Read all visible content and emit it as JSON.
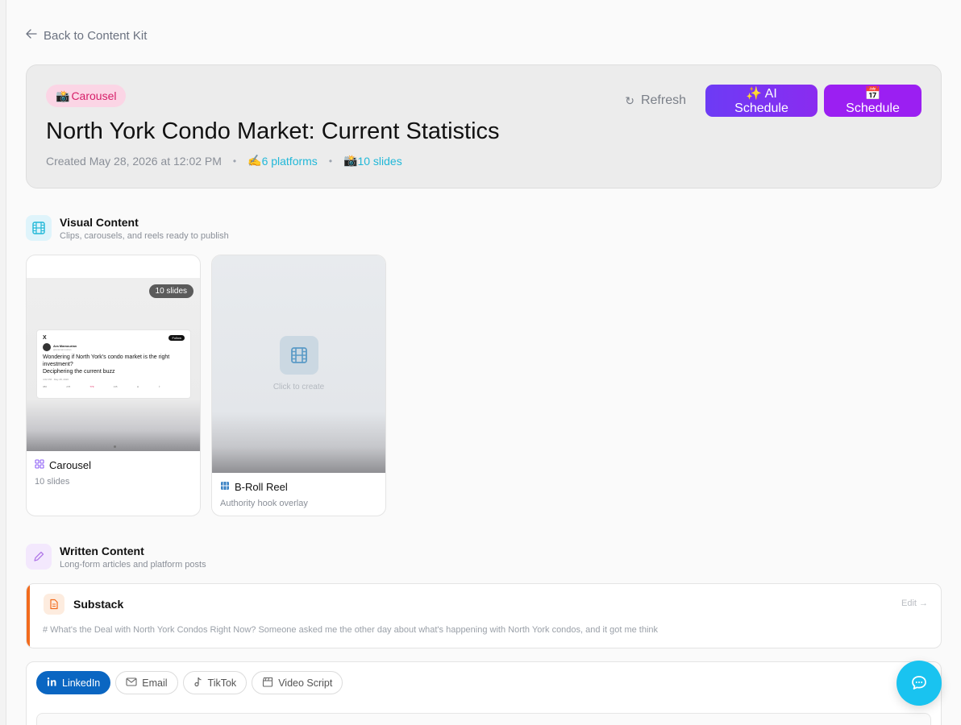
{
  "nav": {
    "back_label": "Back to Content Kit"
  },
  "header": {
    "badge_emoji": "📸",
    "badge_label": "Carousel",
    "title": "North York Condo Market: Current Statistics",
    "created": "Created May 28, 2026 at 12:02 PM",
    "platforms_emoji": "✍️",
    "platforms": "6 platforms",
    "slides_emoji": "📸",
    "slides": "10 slides",
    "refresh_label": "Refresh",
    "ai_schedule_label": "✨ AI Schedule",
    "schedule_label": "📅 Schedule"
  },
  "visual_section": {
    "title": "Visual Content",
    "subtitle": "Clips, carousels, and reels ready to publish",
    "cards": [
      {
        "title": "Carousel",
        "subtitle": "10 slides",
        "badge": "10 slides",
        "preview": {
          "platform_mark": "X",
          "follow": "Follow",
          "author": "Ara Mamourian",
          "handle": "@aramamourian",
          "text_line1": "Wondering if North York's condo market is the right investment?",
          "text_line2": "Deciphering the current buzz",
          "time": "4:02 PM · May 28, 2026",
          "stats": [
            "386",
            "278",
            "779",
            "135",
            "⊡",
            "⇪"
          ]
        }
      },
      {
        "title": "B-Roll Reel",
        "subtitle": "Authority hook overlay",
        "placeholder": "Click to create"
      }
    ]
  },
  "written_section": {
    "title": "Written Content",
    "subtitle": "Long-form articles and platform posts",
    "substack": {
      "title": "Substack",
      "edit_label": "Edit →",
      "excerpt": "# What's the Deal with North York Condos Right Now? Someone asked me the other day about what's happening with North York condos, and it got me think"
    },
    "tabs": [
      {
        "label": "LinkedIn",
        "active": true
      },
      {
        "label": "Email",
        "active": false
      },
      {
        "label": "TikTok",
        "active": false
      },
      {
        "label": "Video Script",
        "active": false
      }
    ]
  },
  "colors": {
    "accent_cyan": "#22b8d8",
    "ai_button": "#6d3bf5",
    "schedule_button": "#9b1ff2",
    "linkedin": "#0a66c2",
    "substack": "#f26b1d",
    "badge_pink": "#d61f69",
    "chat_fab": "#19c3f0"
  }
}
